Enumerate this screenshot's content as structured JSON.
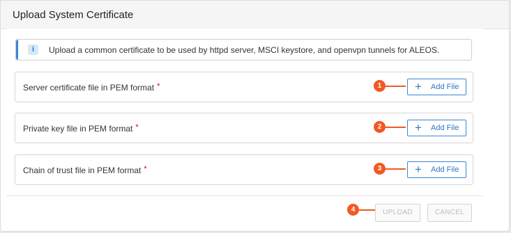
{
  "dialog": {
    "title": "Upload System Certificate",
    "info": {
      "icon": "info-icon",
      "icon_glyph": "i",
      "text": "Upload a common certificate to be used by httpd server, MSCI keystore, and openvpn tunnels for ALEOS."
    },
    "rows": [
      {
        "label": "Server certificate file in PEM format",
        "required_mark": "*",
        "button_icon": "+",
        "button_label": "Add File",
        "step": "1"
      },
      {
        "label": "Private key file in PEM format",
        "required_mark": "*",
        "button_icon": "+",
        "button_label": "Add File",
        "step": "2"
      },
      {
        "label": "Chain of trust file in PEM format",
        "required_mark": "*",
        "button_icon": "+",
        "button_label": "Add File",
        "step": "3"
      }
    ],
    "footer": {
      "upload_label": "UPLOAD",
      "cancel_label": "CANCEL",
      "step": "4"
    }
  },
  "colors": {
    "accent": "#3a86d6",
    "marker": "#f05a22",
    "required": "#d0021b"
  }
}
